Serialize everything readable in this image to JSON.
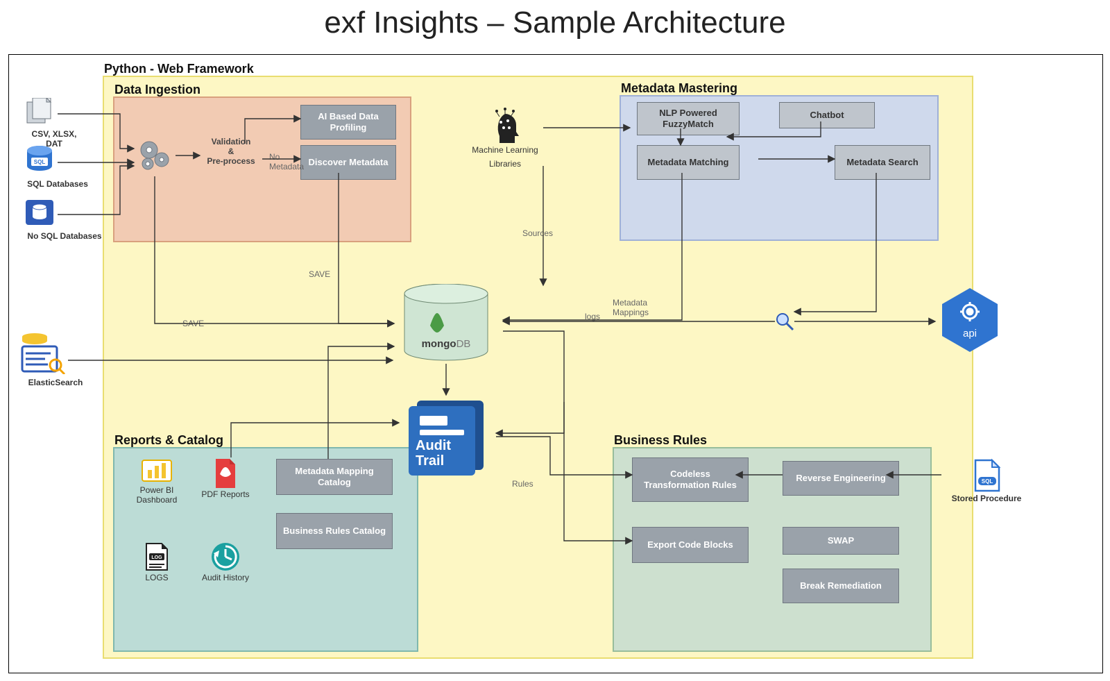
{
  "title": "exf Insights – Sample Architecture",
  "framework_label": "Python - Web Framework",
  "sources": {
    "csv": "CSV, XLSX, DAT",
    "sql": "SQL Databases",
    "nosql": "No SQL Databases",
    "elastic": "ElasticSearch",
    "stored_proc": "Stored Procedure"
  },
  "ingestion": {
    "title": "Data Ingestion",
    "validation": "Validation\n&\nPre-process",
    "ai_profiling": "AI Based\nData Profiling",
    "discover_meta": "Discover\nMetadata",
    "no_meta": "No\nMetadata"
  },
  "ml": {
    "caption_top": "Machine Learning",
    "caption_bottom": "Libraries"
  },
  "mastering": {
    "title": "Metadata Mastering",
    "fuzzy": "NLP Powered\nFuzzyMatch",
    "chatbot": "Chatbot",
    "matching": "Metadata\nMatching",
    "search": "Metadata\nSearch"
  },
  "center": {
    "mongo_word": "mongo",
    "mongo_db": "DB",
    "audit": "Audit\nTrail"
  },
  "reports": {
    "title": "Reports & Catalog",
    "powerbi": "Power BI\nDashboard",
    "pdf": "PDF\nReports",
    "logs": "LOGS",
    "audit_history": "Audit\nHistory",
    "meta_catalog": "Metadata\nMapping Catalog",
    "rules_catalog": "Business Rules\nCatalog"
  },
  "rules": {
    "title": "Business Rules",
    "codeless": "Codeless\nTransformation\nRules",
    "reverse": "Reverse\nEngineering",
    "export": "Export\nCode Blocks",
    "swap": "SWAP",
    "break": "Break\nRemediation"
  },
  "edge_labels": {
    "save1": "SAVE",
    "save2": "SAVE",
    "sources": "Sources",
    "logs": "logs",
    "meta_map": "Metadata\nMappings",
    "rules": "Rules"
  },
  "api_label": "api"
}
